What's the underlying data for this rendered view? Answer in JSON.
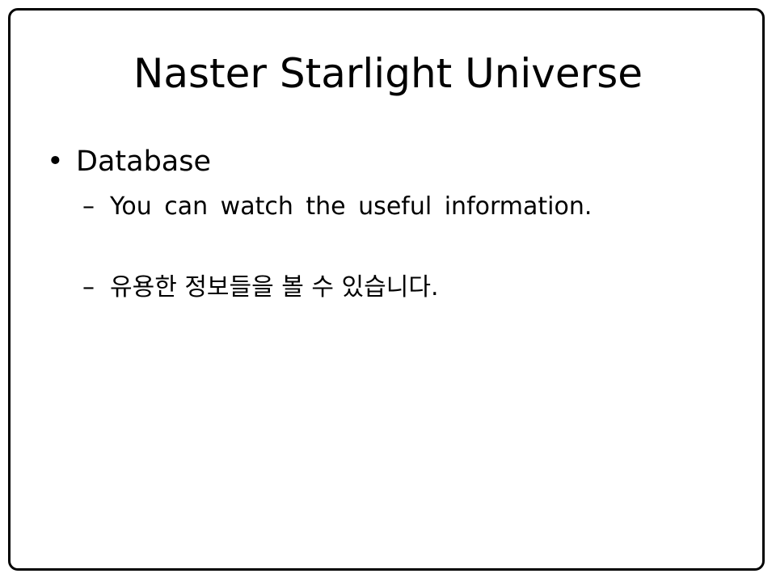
{
  "slide": {
    "title": "Naster Starlight Universe",
    "bullet": {
      "marker": "•",
      "text": "Database"
    },
    "sub_items": [
      {
        "marker": "–",
        "text": "You can watch the useful information."
      },
      {
        "marker": "–",
        "text": "유용한 정보들을 볼 수 있습니다."
      }
    ]
  },
  "colors": {
    "background": "#ffffff",
    "text": "#000000",
    "frame_border": "#000000"
  }
}
